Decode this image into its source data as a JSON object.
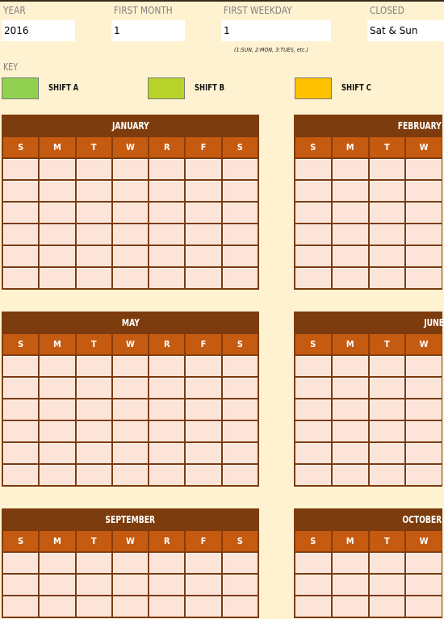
{
  "settings": {
    "year": {
      "label": "YEAR",
      "value": "2016"
    },
    "first_month": {
      "label": "FIRST MONTH",
      "value": "1"
    },
    "first_weekday": {
      "label": "FIRST WEEKDAY",
      "value": "1",
      "hint": "(1:SUN, 2:MON, 3:TUES, etc.)"
    },
    "closed": {
      "label": "CLOSED",
      "value": "Sat & Sun"
    }
  },
  "key": {
    "label": "KEY",
    "shifts": [
      {
        "label": "SHIFT A",
        "color": "#92d050"
      },
      {
        "label": "SHIFT B",
        "color": "#b8d42a"
      },
      {
        "label": "SHIFT C",
        "color": "#ffc000"
      }
    ]
  },
  "weekdays": [
    "S",
    "M",
    "T",
    "W",
    "R",
    "F",
    "S"
  ],
  "months": [
    {
      "name": "JANUARY"
    },
    {
      "name": "FEBRUARY"
    },
    {
      "name": "MAY"
    },
    {
      "name": "JUNE"
    },
    {
      "name": "SEPTEMBER"
    },
    {
      "name": "OCTOBER"
    }
  ],
  "colors": {
    "background": "#fff2d0",
    "month_header": "#7d3c0d",
    "weekday_header": "#c55a11",
    "day_cell": "#fde4d8"
  }
}
